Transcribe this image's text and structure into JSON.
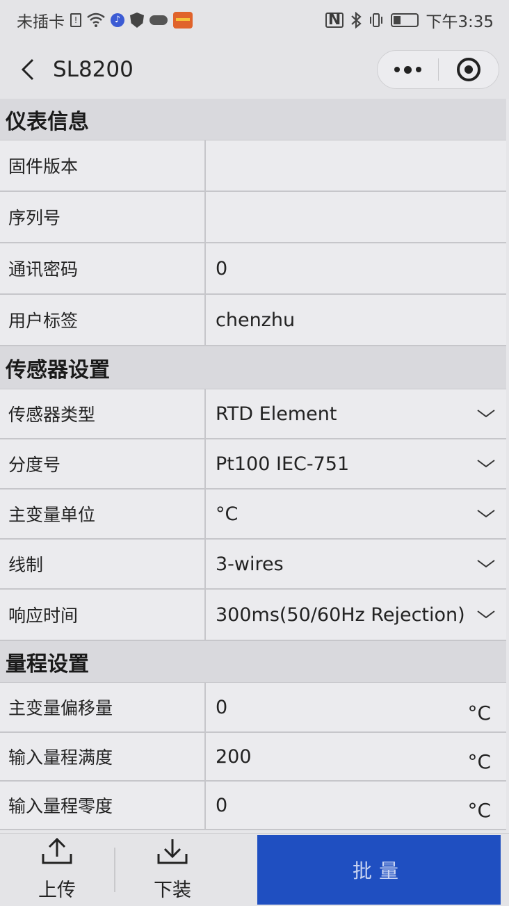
{
  "status_bar": {
    "carrier": "未插卡",
    "time": "下午3:35"
  },
  "nav": {
    "title": "SL8200"
  },
  "sections": {
    "meter_info": {
      "title": "仪表信息",
      "firmware_label": "固件版本",
      "firmware_value": "",
      "serial_label": "序列号",
      "serial_value": "",
      "password_label": "通讯密码",
      "password_value": "0",
      "tag_label": "用户标签",
      "tag_value": "chenzhu"
    },
    "sensor": {
      "title": "传感器设置",
      "type_label": "传感器类型",
      "type_value": "RTD Element",
      "graduation_label": "分度号",
      "graduation_value": "Pt100 IEC-751",
      "unit_label": "主变量单位",
      "unit_value": "°C",
      "wires_label": "线制",
      "wires_value": "3-wires",
      "response_label": "响应时间",
      "response_value": "300ms(50/60Hz Rejection)"
    },
    "range": {
      "title": "量程设置",
      "offset_label": "主变量偏移量",
      "offset_value": "0",
      "offset_unit": "°C",
      "upper_label": "输入量程满度",
      "upper_value": "200",
      "upper_unit": "°C",
      "lower_label": "输入量程零度",
      "lower_value": "0",
      "lower_unit": "°C"
    }
  },
  "bottom": {
    "upload_label": "上传",
    "download_label": "下装",
    "batch_label": "批量"
  },
  "colors": {
    "accent": "#1f4fc1",
    "section_bg": "#d9d9dd",
    "row_bg": "#ebebee"
  }
}
